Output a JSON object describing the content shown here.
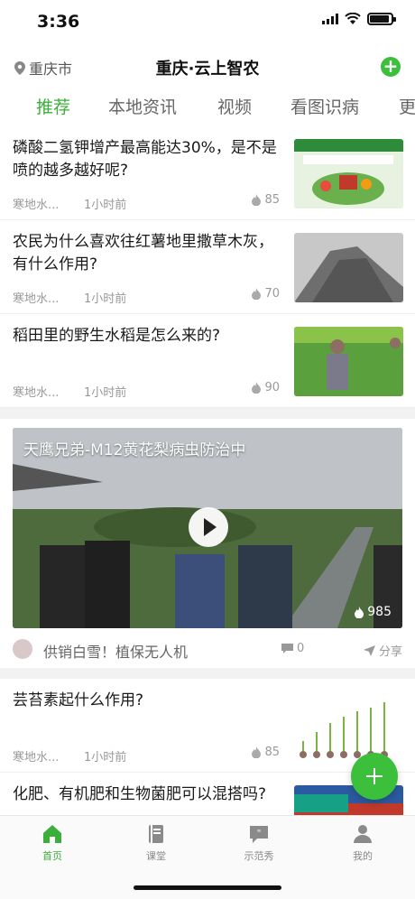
{
  "status_bar": {
    "time": "3:36"
  },
  "header": {
    "location": "重庆市",
    "title": "重庆·云上智农"
  },
  "tabs": [
    {
      "label": "推荐",
      "active": true
    },
    {
      "label": "本地资讯",
      "active": false
    },
    {
      "label": "视频",
      "active": false
    },
    {
      "label": "看图识病",
      "active": false
    },
    {
      "label": "更",
      "active": false
    }
  ],
  "articles": [
    {
      "title": "磷酸二氢钾增产最高能达30%，是不是喷的越多越好呢?",
      "source": "寒地水...",
      "time": "1小时前",
      "views": "85",
      "thumb": "fertilizer-bag-image"
    },
    {
      "title": "农民为什么喜欢往红薯地里撒草木灰，有什么作用?",
      "source": "寒地水...",
      "time": "1小时前",
      "views": "70",
      "thumb": "ash-pile-image"
    },
    {
      "title": "稻田里的野生水稻是怎么来的?",
      "source": "寒地水...",
      "time": "1小时前",
      "views": "90",
      "thumb": "rice-field-image"
    }
  ],
  "video": {
    "title": "天鹰兄弟-M12黄花梨病虫防治中",
    "views": "985",
    "author": "供销白雪！植保无人机",
    "comments": "0",
    "share_label": "分享"
  },
  "articles2": [
    {
      "title": "芸苔素起什么作用?",
      "source": "寒地水...",
      "time": "1小时前",
      "views": "85",
      "thumb": "sprouts-image"
    },
    {
      "title": "化肥、有机肥和生物菌肥可以混搭吗?",
      "source": "",
      "time": "",
      "views": "",
      "thumb": "fertilizer-granules-image"
    }
  ],
  "bottom_tabs": [
    {
      "label": "首页",
      "icon": "home-icon",
      "active": true
    },
    {
      "label": "课堂",
      "icon": "book-icon",
      "active": false
    },
    {
      "label": "示范秀",
      "icon": "chat-icon",
      "active": false
    },
    {
      "label": "我的",
      "icon": "user-icon",
      "active": false
    }
  ],
  "colors": {
    "accent": "#3cbf3a",
    "tab_active": "#3cae3a",
    "divider": "#f2f2f2"
  }
}
